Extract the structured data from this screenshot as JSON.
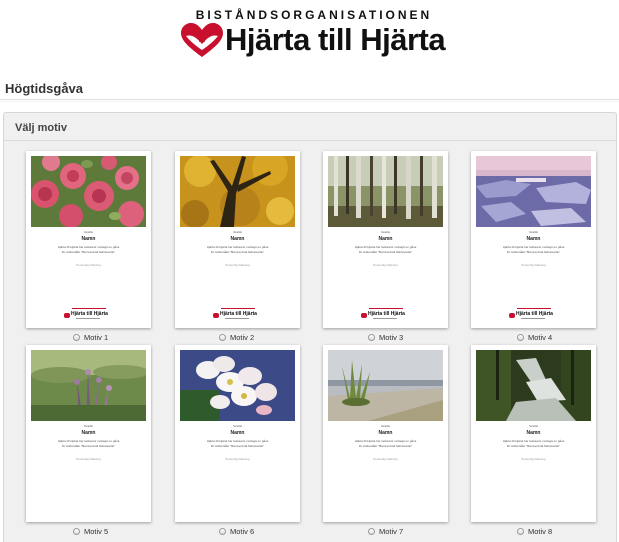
{
  "header": {
    "tagline": "BISTÅNDSORGANISATIONEN",
    "brand": "Hjärta till Hjärta",
    "logo_icon": "heart-logo-icon",
    "brand_color": "#c8102e"
  },
  "page": {
    "title": "Högtidsgåva"
  },
  "panel": {
    "title": "Välj motiv"
  },
  "card_template": {
    "line1": "Grattis",
    "name": "Namn",
    "line3": "Hjärta till Hjärta har tacksamt mottagit en gåva",
    "line4": "för ändamålet \"Barncentralt fattiravarde\"",
    "signature": "Personlig hälsning"
  },
  "motifs": [
    {
      "label": "Motiv 1",
      "image": "pink-roses"
    },
    {
      "label": "Motiv 2",
      "image": "autumn-tree"
    },
    {
      "label": "Motiv 3",
      "image": "birch-forest"
    },
    {
      "label": "Motiv 4",
      "image": "ice-lake-dusk"
    },
    {
      "label": "Motiv 5",
      "image": "heather-field"
    },
    {
      "label": "Motiv 6",
      "image": "apple-blossom"
    },
    {
      "label": "Motiv 7",
      "image": "grass-on-shore"
    },
    {
      "label": "Motiv 8",
      "image": "forest-waterfall"
    }
  ]
}
